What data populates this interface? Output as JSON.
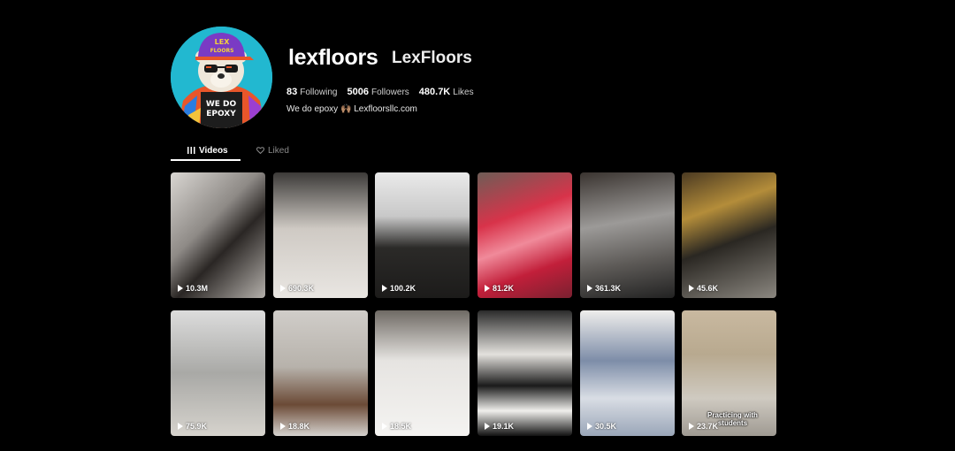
{
  "profile": {
    "username": "lexfloors",
    "nickname": "LexFloors",
    "stats": {
      "following_count": "83",
      "following_label": "Following",
      "followers_count": "5006",
      "followers_label": "Followers",
      "likes_count": "480.7K",
      "likes_label": "Likes"
    },
    "bio": "We do epoxy 🙌🏽 Lexfloorsllc.com",
    "avatar": {
      "hat_text_line1": "LEX",
      "hat_text_line2": "FLOORS",
      "shirt_text_line1": "WE DO",
      "shirt_text_line2": "EPOXY"
    }
  },
  "tabs": {
    "videos": "Videos",
    "liked": "Liked"
  },
  "videos": [
    {
      "views": "10.3M",
      "bg": "linear-gradient(135deg,#d9d6d2 0%,#8e8a86 40%,#2a2624 60%,#b4b0ab 100%)"
    },
    {
      "views": "690.3K",
      "bg": "linear-gradient(180deg,#3c3a38 0%,#cfcac4 45%,#e9e6e2 100%)"
    },
    {
      "views": "100.2K",
      "bg": "linear-gradient(180deg,#eaeaea 0%,#c8c8c8 35%,#2b2a28 60%,#1c1b1a 100%)"
    },
    {
      "views": "81.2K",
      "bg": "linear-gradient(160deg,#6e5d56 0%,#d8334a 35%,#f08a9a 55%,#c21f3a 75%,#7a2030 100%)"
    },
    {
      "views": "361.3K",
      "bg": "linear-gradient(170deg,#3a3430 0%,#9c9a98 40%,#5d5a57 70%,#222 100%)"
    },
    {
      "views": "45.6K",
      "bg": "linear-gradient(160deg,#4b3a22 0%,#b48d3a 30%,#2a2722 55%,#8b8780 100%)"
    },
    {
      "views": "75.9K",
      "bg": "linear-gradient(180deg,#dcdcdc 0%,#a9a9a6 50%,#d6d3cd 100%)"
    },
    {
      "views": "18.8K",
      "bg": "linear-gradient(180deg,#d0cdc9 0%,#b7b2ab 45%,#6b4a36 75%,#d5d2ce 100%)"
    },
    {
      "views": "18.5K",
      "bg": "linear-gradient(180deg,#6f6a64 0%,#e6e4e1 40%,#f4f3f1 100%)"
    },
    {
      "views": "19.1K",
      "bg": "linear-gradient(180deg,#2b2b2b 0%,#e3e1dd 35%,#1b1b1b 60%,#f0efec 80%,#111 100%)"
    },
    {
      "views": "30.5K",
      "bg": "linear-gradient(180deg,#efeeec 0%,#7d8da8 40%,#d9dde4 70%,#9aa6b8 100%)"
    },
    {
      "views": "23.7K",
      "bg": "linear-gradient(180deg,#c9b9a0 0%,#b8a98f 35%,#cfcac1 70%,#9f9a92 100%)",
      "caption": "Practicing with students"
    }
  ]
}
